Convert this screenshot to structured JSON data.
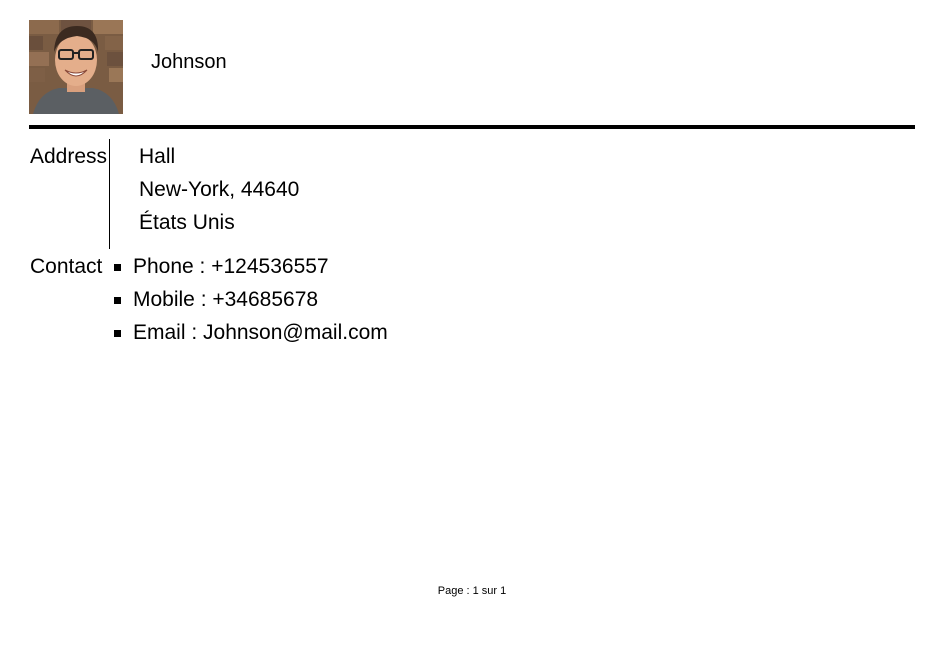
{
  "profile": {
    "name": "Johnson"
  },
  "address": {
    "label": "Address",
    "lines": [
      "Hall",
      "New-York, 44640",
      "États Unis"
    ]
  },
  "contact": {
    "label": "Contact",
    "items": [
      "Phone : +124536557",
      "Mobile : +34685678",
      "Email : Johnson@mail.com"
    ]
  },
  "footer": {
    "page": "Page : 1 sur 1"
  }
}
